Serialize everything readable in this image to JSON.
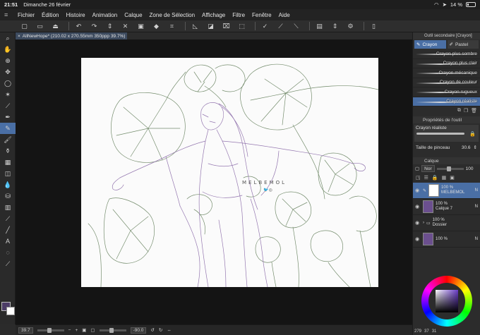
{
  "status": {
    "time": "21:51",
    "date": "Dimanche 26 février",
    "battery": "14 %"
  },
  "menu": [
    "Fichier",
    "Édition",
    "Histoire",
    "Animation",
    "Calque",
    "Zone de Sélection",
    "Affichage",
    "Filtre",
    "Fenêtre",
    "Aide"
  ],
  "document": {
    "tab_label": "AllNewHope* (210.02 x 270.55mm 350ppp 39.7%)"
  },
  "watermark": {
    "text": "MELBEMOL"
  },
  "bottom": {
    "zoom": "39.7",
    "rotation": "-90.0"
  },
  "subtool": {
    "panel_title": "Outil secondaire [Crayon]",
    "tabs": [
      "Crayon",
      "Pastel"
    ],
    "brushes": [
      "Crayon plus sombre",
      "Crayon plus clair",
      "Crayon mécanique",
      "Crayon de couleur",
      "Crayon rugueux",
      "Crayon réaliste"
    ],
    "active_brush_index": 5
  },
  "tool_props": {
    "title": "Propriétés de l'outil",
    "brush_name": "Crayon réaliste",
    "size_label": "Taille de pinceau",
    "size_value": "30.6"
  },
  "layers": {
    "title": "Calque",
    "blend_mode": "Nor",
    "opacity": "100",
    "items": [
      {
        "opacity": "100 %",
        "mode": "N",
        "name": "MELBEMOL"
      },
      {
        "opacity": "100 %",
        "mode": "N",
        "name": "Calque 7"
      },
      {
        "opacity": "100 %",
        "mode": "",
        "name": "Dossier"
      },
      {
        "opacity": "100 %",
        "mode": "N",
        "name": ""
      }
    ]
  },
  "color": {
    "main": "#4c3c67",
    "sub": "#ffffff",
    "pixel_values": [
      "279",
      "37",
      "31"
    ]
  },
  "colors": {
    "accent": "#4a6fa5",
    "line_green": "#5e7a55",
    "line_purple": "#8a6aa8"
  }
}
